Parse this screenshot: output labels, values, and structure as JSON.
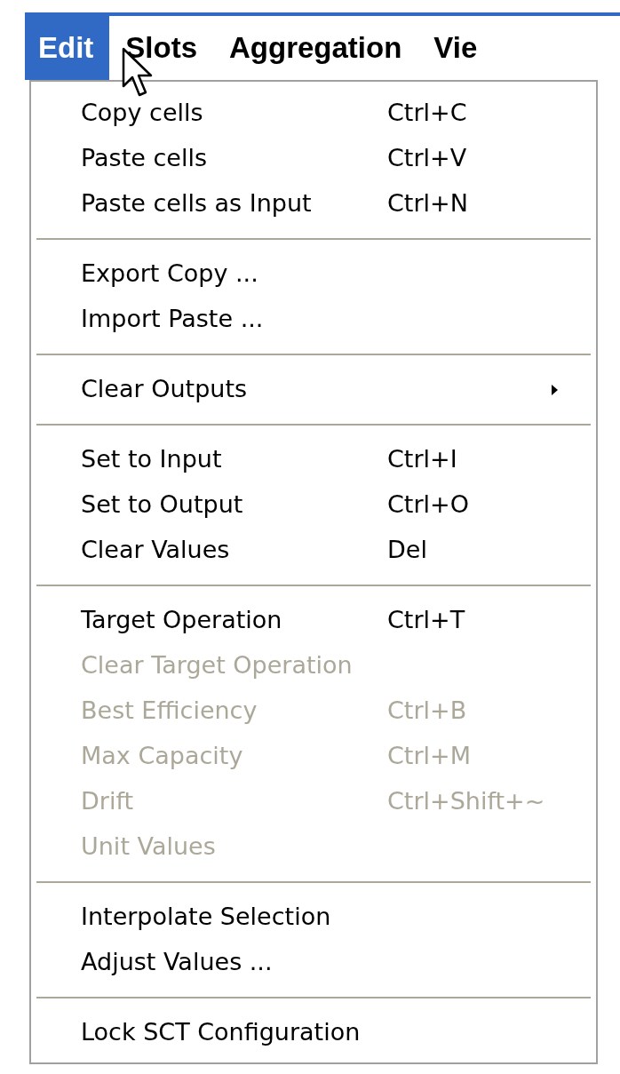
{
  "menu_bar": [
    {
      "label": "Edit",
      "selected": true
    },
    {
      "label": "Slots",
      "selected": false
    },
    {
      "label": "Aggregation",
      "selected": false
    },
    {
      "label": "Vie",
      "selected": false
    }
  ],
  "menu": {
    "sections": [
      [
        {
          "kind": "item",
          "label": "Copy cells",
          "shortcut": "Ctrl+C",
          "disabled": false
        },
        {
          "kind": "item",
          "label": "Paste cells",
          "shortcut": "Ctrl+V",
          "disabled": false
        },
        {
          "kind": "item",
          "label": "Paste cells as Input",
          "shortcut": "Ctrl+N",
          "disabled": false
        }
      ],
      [
        {
          "kind": "item",
          "label": "Export Copy ...",
          "disabled": false
        },
        {
          "kind": "item",
          "label": "Import Paste ...",
          "disabled": false
        }
      ],
      [
        {
          "kind": "submenu",
          "label": "Clear Outputs",
          "disabled": false
        }
      ],
      [
        {
          "kind": "item",
          "label": "Set to Input",
          "shortcut": "Ctrl+I",
          "disabled": false
        },
        {
          "kind": "item",
          "label": "Set to Output",
          "shortcut": "Ctrl+O",
          "disabled": false
        },
        {
          "kind": "item",
          "label": "Clear Values",
          "shortcut": "Del",
          "disabled": false
        }
      ],
      [
        {
          "kind": "item",
          "label": "Target Operation",
          "shortcut": "Ctrl+T",
          "disabled": false
        },
        {
          "kind": "item",
          "label": "Clear Target Operation",
          "disabled": true
        },
        {
          "kind": "item",
          "label": "Best Efficiency",
          "shortcut": "Ctrl+B",
          "disabled": true
        },
        {
          "kind": "item",
          "label": "Max Capacity",
          "shortcut": "Ctrl+M",
          "disabled": true
        },
        {
          "kind": "item",
          "label": "Drift",
          "shortcut": "Ctrl+Shift+~",
          "disabled": true
        },
        {
          "kind": "item",
          "label": "Unit Values",
          "disabled": true
        }
      ],
      [
        {
          "kind": "item",
          "label": "Interpolate Selection",
          "disabled": false
        },
        {
          "kind": "item",
          "label": "Adjust Values ...",
          "disabled": false
        }
      ],
      [
        {
          "kind": "item",
          "label": "Lock SCT Configuration",
          "disabled": false
        }
      ]
    ]
  }
}
